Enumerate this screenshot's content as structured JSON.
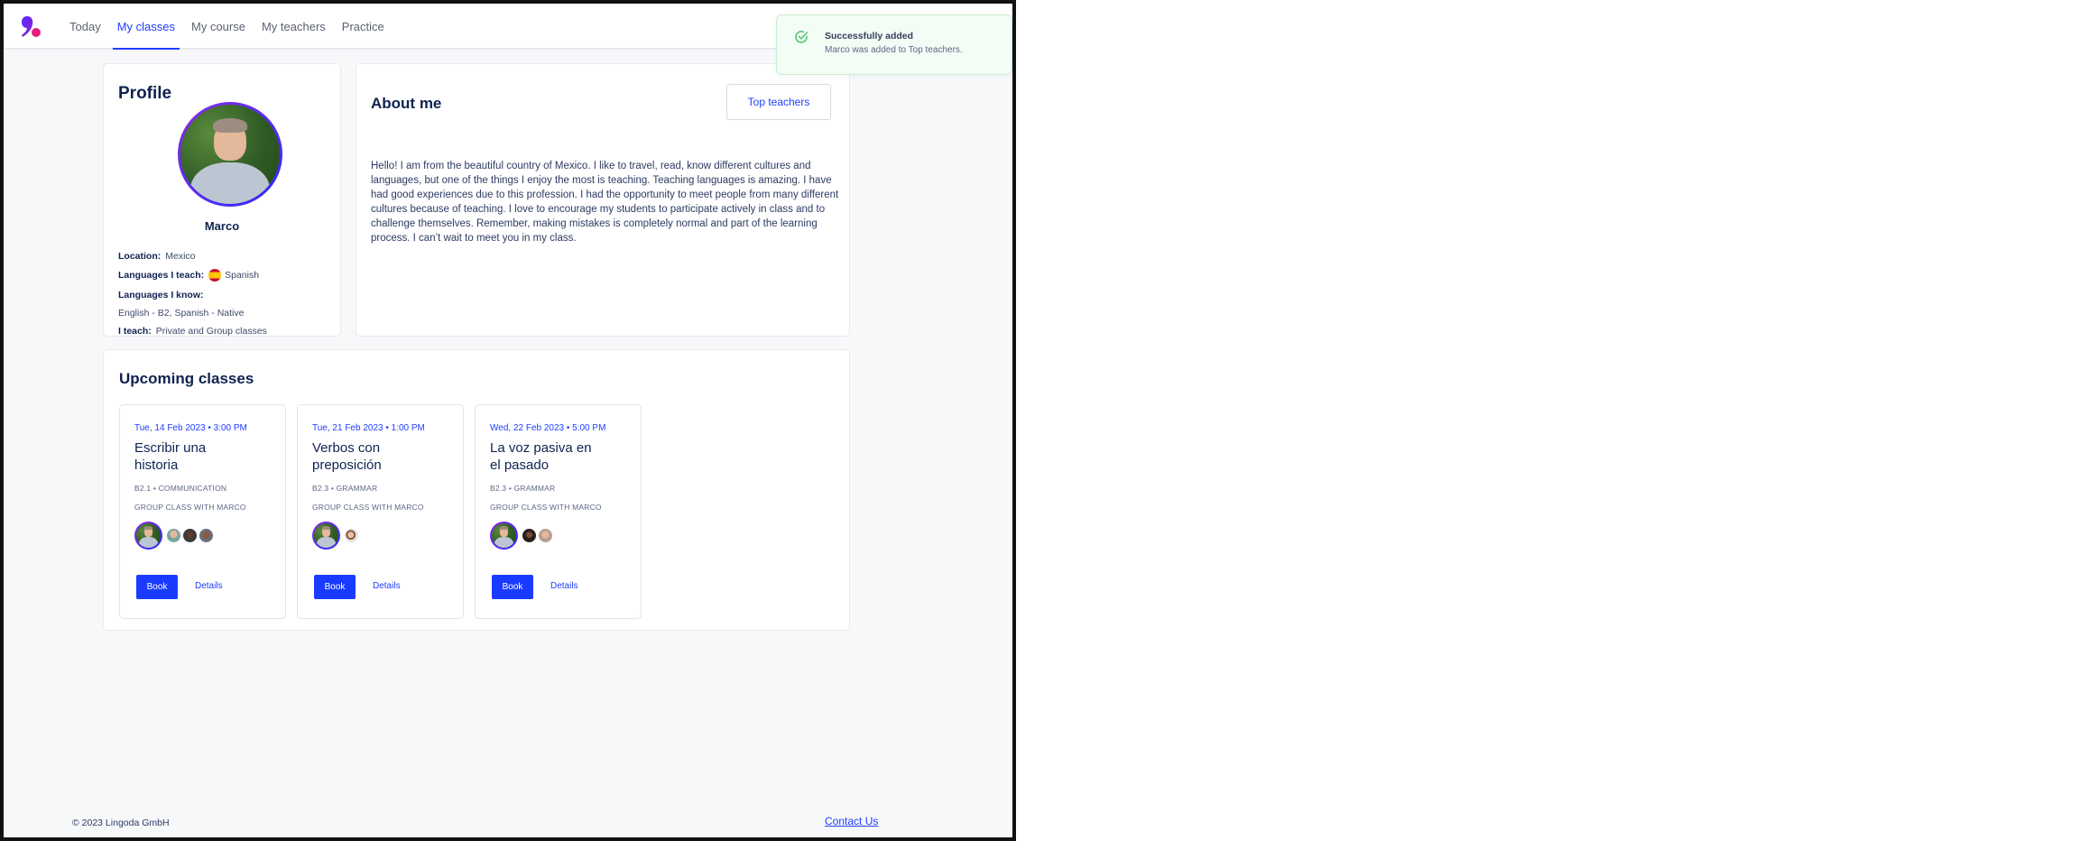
{
  "nav": {
    "logo": "lingoda-logo",
    "items": [
      {
        "label": "Today",
        "active": false
      },
      {
        "label": "My classes",
        "active": true
      },
      {
        "label": "My course",
        "active": false
      },
      {
        "label": "My teachers",
        "active": false
      },
      {
        "label": "Practice",
        "active": false
      }
    ]
  },
  "toast": {
    "icon": "check-circle-icon",
    "title": "Successfully added",
    "message": "Marco was added to Top teachers."
  },
  "profile": {
    "heading": "Profile",
    "name": "Marco",
    "location_label": "Location:",
    "location": "Mexico",
    "teaches_label": "Languages I teach:",
    "teaches_flag": "spain-flag-icon",
    "teaches": "Spanish",
    "knows_label": "Languages I know:",
    "knows": "English - B2, Spanish - Native",
    "classes_label": "I teach:",
    "classes": "Private and Group classes"
  },
  "about": {
    "heading": "About me",
    "top_teachers_button": "Top teachers",
    "text": "Hello! I am from the beautiful country of Mexico. I like to travel, read, know different cultures and languages, but one of the things I enjoy the most is teaching. Teaching languages is amazing. I have had good experiences due to this profession. I had the opportunity to meet people from many different cultures because of teaching. I love to encourage my students to participate actively in class and to challenge themselves. Remember, making mistakes is completely normal and part of the learning process. I can’t wait to meet you in my class."
  },
  "upcoming": {
    "heading": "Upcoming classes",
    "classes": [
      {
        "date": "Tue, 14 Feb 2023 • 3:00 PM",
        "title": "Escribir una historia",
        "meta": "B2.1 •  COMMUNICATION",
        "host": "GROUP CLASS WITH MARCO",
        "student_count": 3,
        "book": "Book",
        "details": "Details"
      },
      {
        "date": "Tue, 21 Feb 2023 • 1:00 PM",
        "title": "Verbos con preposición",
        "meta": "B2.3 •  GRAMMAR",
        "host": "GROUP CLASS WITH MARCO",
        "student_count": 1,
        "book": "Book",
        "details": "Details"
      },
      {
        "date": "Wed, 22 Feb 2023 • 5:00 PM",
        "title": "La voz pasiva en el pasado",
        "meta": "B2.3 •  GRAMMAR",
        "host": "GROUP CLASS WITH MARCO",
        "student_count": 2,
        "book": "Book",
        "details": "Details"
      }
    ]
  },
  "footer": {
    "copyright": "© 2023 Lingoda GmbH",
    "contact": "Contact Us"
  },
  "colors": {
    "accent": "#1f3dff",
    "text_dark": "#0f2350",
    "toast_bg": "#f3fcf5",
    "toast_check": "#4cc36a",
    "page_bg": "#f7f8fa"
  }
}
